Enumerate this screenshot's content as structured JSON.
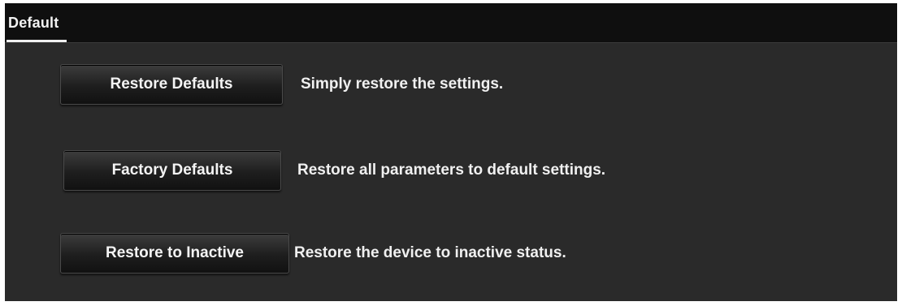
{
  "window": {
    "tab_title": "Default"
  },
  "actions": [
    {
      "button_label": "Restore Defaults",
      "description": "Simply restore the settings."
    },
    {
      "button_label": "Factory Defaults",
      "description": "Restore all parameters to default settings."
    },
    {
      "button_label": "Restore to Inactive",
      "description": "Restore the device to inactive status."
    }
  ],
  "colors": {
    "panel_background": "#2a2a2a",
    "title_bar": "#0f0f0f",
    "text": "#f0f0f0",
    "button_top": "#3d3d3d",
    "button_bottom": "#111111"
  }
}
